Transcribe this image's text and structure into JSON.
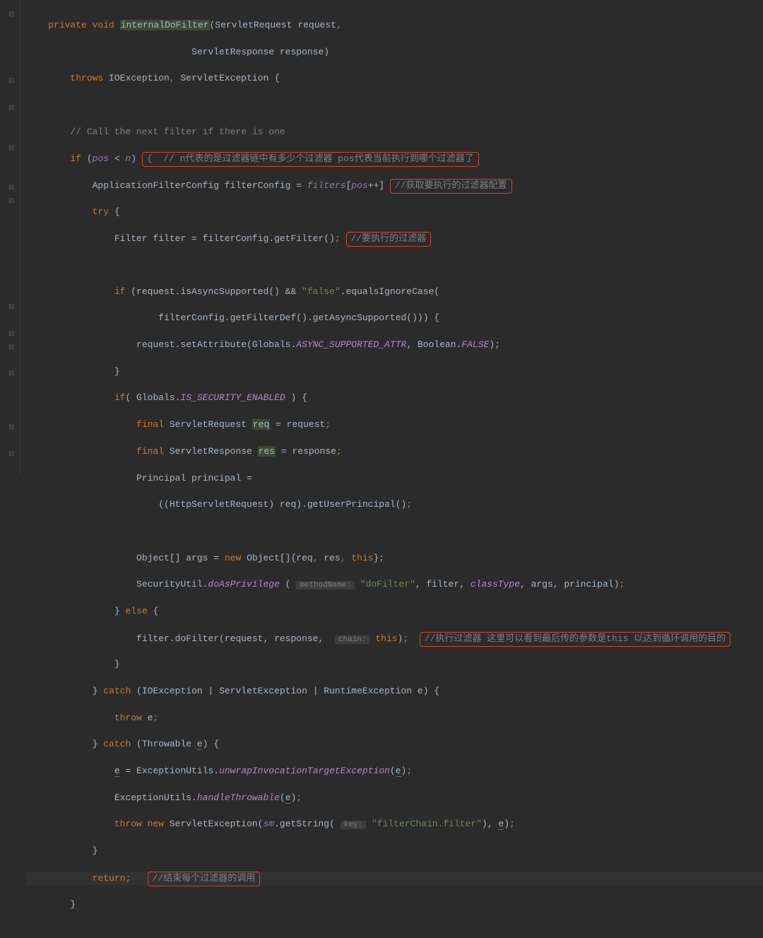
{
  "code": {
    "l1": {
      "kw1": "private",
      "kw2": "void",
      "method": "internalDoFilter",
      "sig1": "(ServletRequest request",
      "p1": ","
    },
    "l2": {
      "txt": "ServletResponse response)"
    },
    "l3": {
      "kw": "throws",
      "t": " IOException",
      "c": ",",
      "t2": " ServletException {"
    },
    "l5": {
      "cmt": "// Call the next filter if there is one"
    },
    "l6": {
      "kw": "if",
      "o": " (",
      "p1": "pos",
      "lt": " < ",
      "p2": "n",
      "c": ") ",
      "box": "{  // n代表的是过滤器链中有多少个过滤器 pos代表当前执行到哪个过滤器了"
    },
    "l7": {
      "t": "ApplicationFilterConfig filterConfig = ",
      "f": "filters",
      "b": "[",
      "p": "pos",
      "op": "++]",
      "box": "//获取要执行的过滤器配置"
    },
    "l8": {
      "kw": "try",
      "b": " {"
    },
    "l9": {
      "t": "Filter filter = filterConfig.getFilter()",
      "p": ";",
      "box": "//要执行的过滤器"
    },
    "l11": {
      "kw": "if",
      "t": " (request.isAsyncSupported() && ",
      "s": "\"false\"",
      "t2": ".equalsIgnoreCase("
    },
    "l12": {
      "t": "filterConfig.getFilterDef().getAsyncSupported())) {"
    },
    "l13": {
      "t": "request.setAttribute(Globals.",
      "c": "ASYNC_SUPPORTED_ATTR",
      "t2": ", Boolean.",
      "c2": "FALSE",
      "t3": ");"
    },
    "l14": {
      "t": "}"
    },
    "l15": {
      "kw": "if",
      "t": "( Globals.",
      "c": "IS_SECURITY_ENABLED",
      "t2": " ) {"
    },
    "l16": {
      "kw": "final",
      "t": " ServletRequest ",
      "v": "req",
      "t2": " = request",
      "p": ";"
    },
    "l17": {
      "kw": "final",
      "t": " ServletResponse ",
      "v": "res",
      "t2": " = response",
      "p": ";"
    },
    "l18": {
      "t": "Principal principal ="
    },
    "l19": {
      "t": "((HttpServletRequest) req).getUserPrincipal()",
      "p": ";"
    },
    "l21": {
      "t": "Object[] args = ",
      "kw": "new",
      "t2": " Object[]{",
      "v1": "req",
      "c1": ", ",
      "v2": "res",
      "c2": ", ",
      "kw2": "this",
      "t3": "};"
    },
    "l22": {
      "t": "SecurityUtil.",
      "m": "doAsPrivilege",
      "t2": " ( ",
      "h1": "methodName:",
      "s": "\"doFilter\"",
      "c1": ", filter, ",
      "p": "classType",
      "c2": ", args, principal)",
      "sc": ";"
    },
    "l23": {
      "t": "} ",
      "kw": "else",
      "t2": " {"
    },
    "l24": {
      "t": "filter.doFilter(request, response, ",
      "h": "chain:",
      "kw": "this",
      "t2": ")",
      "sc": ";",
      "box": "//执行过滤器 这里可以看到最后传的参数是this 以达到循环调用的目的"
    },
    "l25": {
      "t": "}"
    },
    "l26": {
      "t": "} ",
      "kw": "catch",
      "t2": " (IOException | ServletException | RuntimeException e) {"
    },
    "l27": {
      "kw": "throw",
      "t": " e",
      "p": ";"
    },
    "l28": {
      "t": "} ",
      "kw": "catch",
      "t2": " (Throwable ",
      "v": "e",
      "t3": ") {"
    },
    "l29": {
      "v": "e",
      "t": " = ExceptionUtils.",
      "m": "unwrapInvocationTargetException",
      "t2": "(",
      "v2": "e",
      "t3": ")",
      "p": ";"
    },
    "l30": {
      "t": "ExceptionUtils.",
      "m": "handleThrowable",
      "t2": "(",
      "v": "e",
      "t3": ")",
      "p": ";"
    },
    "l31": {
      "kw": "throw new",
      "t": " ServletException(",
      "f": "sm",
      "t2": ".getString( ",
      "h": "key:",
      "s": "\"filterChain.filter\"",
      "t3": "), ",
      "v": "e",
      "t4": ")",
      "p": ";"
    },
    "l32": {
      "t": "}"
    },
    "l33": {
      "kw": "return",
      "p": ";",
      "box": "//结束每个过滤器的调用"
    },
    "l34": {
      "t": "}"
    }
  }
}
